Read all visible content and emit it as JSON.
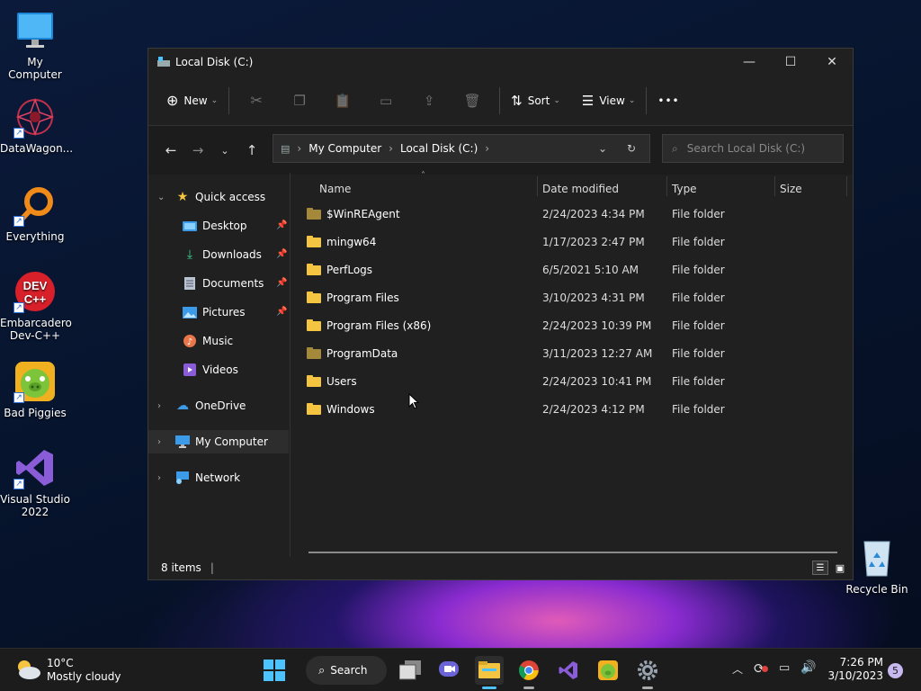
{
  "desktop": {
    "icons": [
      {
        "label": "My Computer"
      },
      {
        "label": "DataWagon..."
      },
      {
        "label": "Everything"
      },
      {
        "label": "Embarcadero Dev-C++"
      },
      {
        "label": "Bad Piggies"
      },
      {
        "label": "Visual Studio 2022"
      },
      {
        "label": "Recycle Bin"
      }
    ]
  },
  "window": {
    "title": "Local Disk (C:)",
    "minimize": "—",
    "maximize": "☐",
    "close": "✕",
    "toolbar": {
      "new_label": "New",
      "sort_label": "Sort",
      "view_label": "View",
      "more_label": "•••"
    },
    "address": {
      "crumbs": [
        "My Computer",
        "Local Disk (C:)"
      ],
      "search_placeholder": "Search Local Disk (C:)"
    },
    "nav": {
      "quick_access": "Quick access",
      "items": [
        {
          "label": "Desktop",
          "pinned": true
        },
        {
          "label": "Downloads",
          "pinned": true
        },
        {
          "label": "Documents",
          "pinned": true
        },
        {
          "label": "Pictures",
          "pinned": true
        },
        {
          "label": "Music",
          "pinned": false
        },
        {
          "label": "Videos",
          "pinned": false
        }
      ],
      "onedrive": "OneDrive",
      "my_computer": "My Computer",
      "network": "Network"
    },
    "columns": {
      "name": "Name",
      "date": "Date modified",
      "type": "Type",
      "size": "Size"
    },
    "files": [
      {
        "name": "$WinREAgent",
        "date": "2/24/2023 4:34 PM",
        "type": "File folder",
        "hidden": true
      },
      {
        "name": "mingw64",
        "date": "1/17/2023 2:47 PM",
        "type": "File folder",
        "hidden": false
      },
      {
        "name": "PerfLogs",
        "date": "6/5/2021 5:10 AM",
        "type": "File folder",
        "hidden": false
      },
      {
        "name": "Program Files",
        "date": "3/10/2023 4:31 PM",
        "type": "File folder",
        "hidden": false
      },
      {
        "name": "Program Files (x86)",
        "date": "2/24/2023 10:39 PM",
        "type": "File folder",
        "hidden": false
      },
      {
        "name": "ProgramData",
        "date": "3/11/2023 12:27 AM",
        "type": "File folder",
        "hidden": true
      },
      {
        "name": "Users",
        "date": "2/24/2023 10:41 PM",
        "type": "File folder",
        "hidden": false
      },
      {
        "name": "Windows",
        "date": "2/24/2023 4:12 PM",
        "type": "File folder",
        "hidden": false
      }
    ],
    "status": "8 items"
  },
  "taskbar": {
    "weather_temp": "10°C",
    "weather_desc": "Mostly cloudy",
    "search_label": "Search",
    "time": "7:26 PM",
    "date": "3/10/2023",
    "notification_count": "5"
  },
  "colors": {
    "folder": "#f5c542",
    "folder_hidden": "#a5893a",
    "accent": "#4cc2ff"
  }
}
